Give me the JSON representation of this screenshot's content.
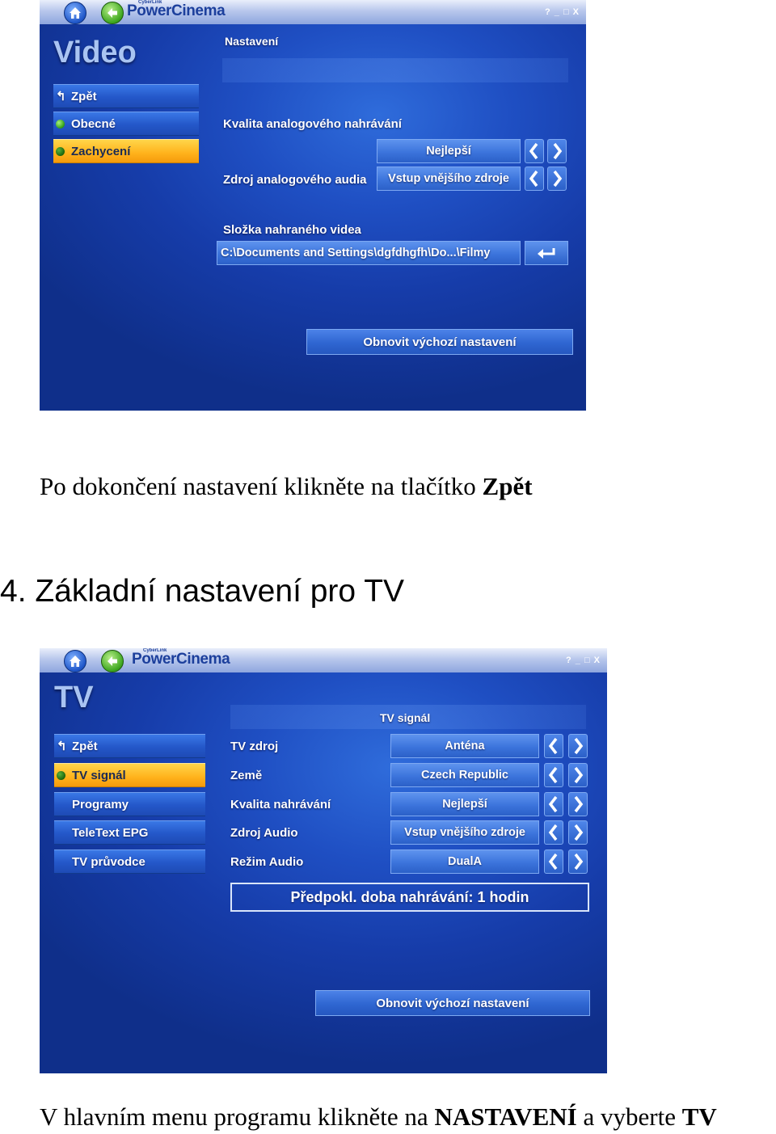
{
  "screen1": {
    "brand": "PowerCinema",
    "brand_small": "CyberLink",
    "window_controls": "? _ □ X",
    "section_title": "Video",
    "header_title": "Nastavení",
    "menu": [
      {
        "label": "Zpět"
      },
      {
        "label": "Obecné"
      },
      {
        "label": "Zachycení"
      }
    ],
    "quality_label": "Kvalita analogového nahrávání",
    "quality_value": "Nejlepší",
    "audio_label": "Zdroj analogového audia",
    "audio_value": "Vstup vnějšího zdroje",
    "folder_label": "Složka nahraného videa",
    "folder_value": "C:\\Documents and Settings\\dgfdhgfh\\Do...\\Filmy",
    "reset_label": "Obnovit výchozí nastavení"
  },
  "caption1": {
    "prefix": "Po dokončení nastavení klikněte na tlačítko ",
    "bold": "Zpět"
  },
  "heading": "4. Základní nastavení pro TV",
  "screen2": {
    "brand": "PowerCinema",
    "brand_small": "CyberLink",
    "window_controls": "? _ □ X",
    "section_title": "TV",
    "header_title": "TV signál",
    "menu": [
      {
        "label": "Zpět"
      },
      {
        "label": "TV signál"
      },
      {
        "label": "Programy"
      },
      {
        "label": "TeleText EPG"
      },
      {
        "label": "TV průvodce"
      }
    ],
    "settings": [
      {
        "label": "TV zdroj",
        "value": "Anténa"
      },
      {
        "label": "Země",
        "value": "Czech Republic"
      },
      {
        "label": "Kvalita nahrávání",
        "value": "Nejlepší"
      },
      {
        "label": "Zdroj Audio",
        "value": "Vstup vnějšího zdroje"
      },
      {
        "label": "Režim Audio",
        "value": "DualA"
      }
    ],
    "info": "Předpokl. doba nahrávání: 1 hodin",
    "reset_label": "Obnovit výchozí nastavení"
  },
  "caption2": {
    "part1": "V hlavním menu programu klikněte na ",
    "bold1": "NASTAVENÍ",
    "part2": " a vyberte ",
    "bold2": "TV"
  }
}
